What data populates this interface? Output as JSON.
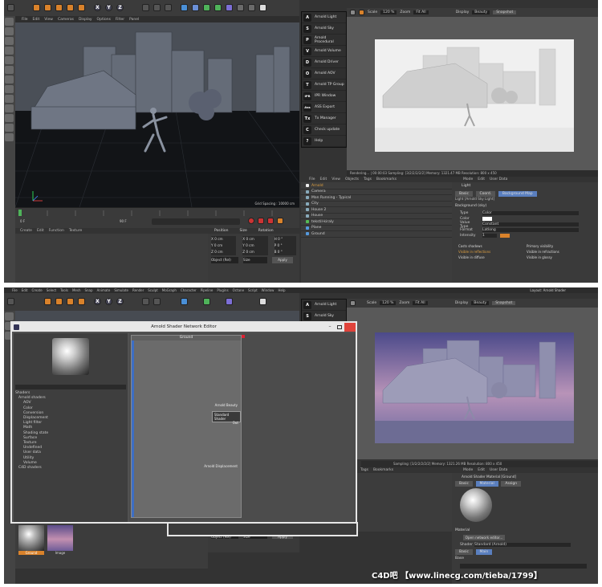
{
  "top": {
    "menu": [
      "File",
      "Edit",
      "View",
      "Cameras",
      "Display",
      "Options",
      "Filter",
      "Panel"
    ],
    "viewport_label": "Perspective",
    "grid_spacing": "Grid Spacing : 10000 cm",
    "arnold_menu": [
      {
        "label": "Arnold Light",
        "icon": "A"
      },
      {
        "label": "Arnold Sky",
        "icon": "S"
      },
      {
        "label": "Arnold Procedural",
        "icon": "P"
      },
      {
        "label": "Arnold Volume",
        "icon": "V"
      },
      {
        "label": "Arnold Driver",
        "icon": "D"
      },
      {
        "label": "Arnold AOV",
        "icon": "O"
      },
      {
        "label": "Arnold TP Group",
        "icon": "T"
      },
      {
        "label": "IPR Window",
        "icon": "IPR"
      },
      {
        "label": "ASS Export",
        "icon": "Ass"
      },
      {
        "label": "Tx Manager",
        "icon": "Tx"
      },
      {
        "label": "Check update",
        "icon": "C"
      },
      {
        "label": "Help",
        "icon": "?"
      }
    ],
    "ipr_toolbar": {
      "zoom_label": "Scale",
      "zoom": "120 %",
      "zoom2_label": "Zoom",
      "zoom2": "Fit All",
      "display_label": "Display",
      "display": "Beauty",
      "snapshot": "Snapshot"
    },
    "render_status": "Rendering... | 00:00:03 Sampling: [3/2/2/2/2/2] Memory: 1321.47 MB Resolution: 800 x 450",
    "objects_menu": [
      "File",
      "Edit",
      "View",
      "Objects",
      "Tags",
      "Bookmarks"
    ],
    "objects": [
      {
        "name": "Arnold",
        "level": 0
      },
      {
        "name": "Camera",
        "level": 0
      },
      {
        "name": "Man Running - Typical",
        "level": 0
      },
      {
        "name": "City",
        "level": 0
      },
      {
        "name": "House 2",
        "level": 0
      },
      {
        "name": "House",
        "level": 0
      },
      {
        "name": "tekstil-kiraly",
        "level": 0
      },
      {
        "name": "Plane",
        "level": 0
      },
      {
        "name": "Ground",
        "level": 0
      }
    ],
    "attr_menu": [
      "Mode",
      "Edit",
      "User Data"
    ],
    "attr_object": "Light",
    "attr_subtitle": "Light [Arnold Sky Light]",
    "attr_tabs": [
      "Basic",
      "Coord.",
      "Background Map"
    ],
    "attr_section": "Background (sky)",
    "attr_fields": [
      {
        "label": "Type",
        "value": "Color"
      },
      {
        "label": "Color",
        "value": ""
      },
      {
        "label": "Value Type",
        "value": "Constant"
      },
      {
        "label": "Format",
        "value": "Latlong"
      },
      {
        "label": "Intensity",
        "value": "1"
      }
    ],
    "visibility": [
      "Casts shadows",
      "Primary visibility",
      "Visible in reflections",
      "Visible in refractions",
      "Visible in diffuse",
      "Visible in glossy"
    ],
    "coord_headers": [
      "Position",
      "Size",
      "Rotation"
    ],
    "coord_rows": [
      [
        "X  0 cm",
        "X  0 cm",
        "H  0 °"
      ],
      [
        "Y  0 cm",
        "Y  0 cm",
        "P  0 °"
      ],
      [
        "Z  0 cm",
        "Z  0 cm",
        "B  0 °"
      ]
    ],
    "coord_mode": [
      "Object (Rel)",
      "Size",
      "Apply"
    ],
    "timeline_start": "0 F",
    "timeline_end": "90 F"
  },
  "bottom": {
    "menu": [
      "File",
      "Edit",
      "Create",
      "Select",
      "Tools",
      "Mesh",
      "Snap",
      "Animate",
      "Simulate",
      "Render",
      "Sculpt",
      "MoGraph",
      "Character",
      "Pipeline",
      "Plugins",
      "Octane",
      "Script",
      "Window",
      "Help"
    ],
    "layout": "Layout: Arnold Shader",
    "editor_title": "Arnold Shader Network Editor",
    "node_title": "Ground",
    "node_ports": [
      "Arnold Beauty",
      "Standard Shader",
      "Out",
      "Arnold Displacement"
    ],
    "tree_root": "Shaders",
    "tree_group": "Arnold shaders",
    "tree_items": [
      "AOV",
      "Color",
      "Conversion",
      "Displacement",
      "Light filter",
      "Math",
      "Shading state",
      "Surface",
      "Texture",
      "Undefined",
      "User data",
      "Utility",
      "Volume"
    ],
    "tree_c4d": "C4D shaders",
    "mat1": "Ground",
    "mat2": "Image",
    "attr_title": "Arnold Shader Material [Ground]",
    "attr_tabs": [
      "Basic",
      "Material",
      "Assign"
    ],
    "attr_section": "Material",
    "open_network": "Open network editor...",
    "shader_label": "Shader",
    "shader_value": "Standard (Arnold)",
    "base_tabs": [
      "Basic",
      "Main"
    ],
    "base_label": "Base",
    "render_status": "Sampling: [3/2/2/2/2/2] Memory: 1321.26 MB Resolution: 800 x 450",
    "watermark": "C4D吧  【www.linecg.com/tieba/1799】"
  }
}
